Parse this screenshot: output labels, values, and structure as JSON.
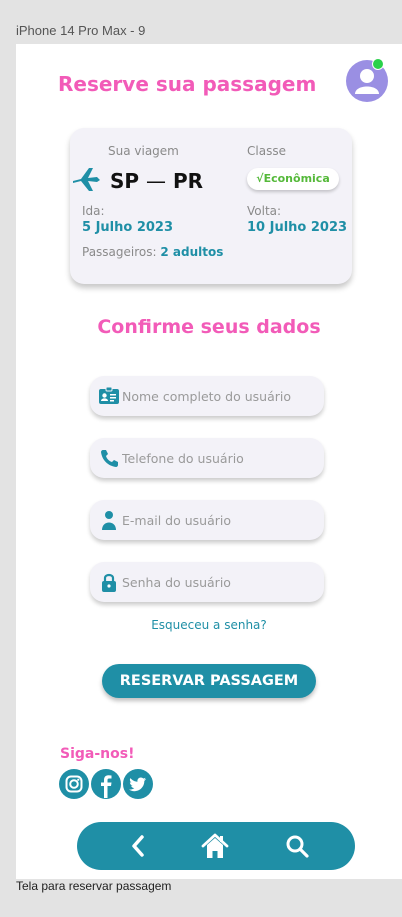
{
  "frame": {
    "label": "iPhone 14 Pro Max - 9"
  },
  "caption": "Tela para reservar passagem",
  "header": {
    "title": "Reserve sua passagem"
  },
  "trip": {
    "trip_label": "Sua viagem",
    "route_from": "SP",
    "route_separator": "—",
    "route_to": "PR",
    "class_label": "Classe",
    "class_value": "√Econômica",
    "outbound_label": "Ida:",
    "outbound_date": "5 Julho 2023",
    "return_label": "Volta:",
    "return_date": "10 Julho 2023",
    "passengers_label": "Passageiros:",
    "passengers_value": "2 adultos"
  },
  "form": {
    "title": "Confirme seus dados",
    "fields": {
      "name": {
        "placeholder": "Nome completo do usuário",
        "value": ""
      },
      "phone": {
        "placeholder": "Telefone do usuário",
        "value": ""
      },
      "email": {
        "placeholder": "E-mail do usuário",
        "value": ""
      },
      "password": {
        "placeholder": "Senha do usuário",
        "value": ""
      }
    },
    "forgot_password": "Esqueceu a senha?",
    "submit_label": "RESERVAR PASSAGEM"
  },
  "social": {
    "label": "Siga-nos!",
    "icons": [
      "instagram-icon",
      "facebook-icon",
      "twitter-icon"
    ]
  },
  "nav": {
    "icons": [
      "back-chevron-icon",
      "home-icon",
      "search-icon"
    ]
  },
  "colors": {
    "accent_pink": "#f25bb8",
    "primary_teal": "#1f8fa6",
    "avatar_purple": "#9a8fe3",
    "status_green": "#29d14a",
    "badge_green": "#55b93a"
  }
}
